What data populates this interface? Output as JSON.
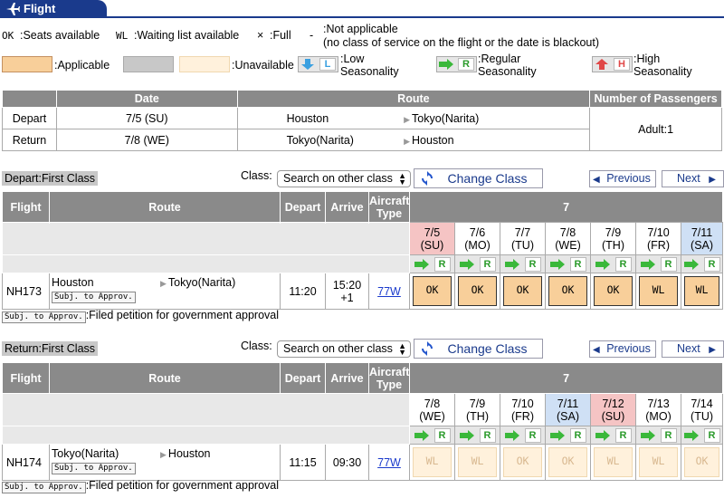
{
  "header": {
    "title": "Flight"
  },
  "legend": {
    "seats_code": "OK",
    "seats_label": ":Seats available",
    "wait_code": "WL",
    "wait_label": ":Waiting list available",
    "full_code": "×",
    "full_label": ":Full",
    "na_code": "-",
    "na_label": ":Not applicable",
    "na_detail": "(no class of service on the flight or the date is blackout)",
    "applicable_label": ":Applicable",
    "unavailable_label": ":Unavailable",
    "low_letter": "L",
    "low_label1": ":Low",
    "low_label2": "Seasonality",
    "regular_letter": "R",
    "regular_label1": ":Regular",
    "regular_label2": "Seasonality",
    "high_letter": "H",
    "high_label1": ":High",
    "high_label2": "Seasonality",
    "colors": {
      "applicable": "#f8cf9a",
      "gray": "#c8c8c8",
      "unavailable": "#fff1dc",
      "low": "#3aa0e0",
      "regular": "#3ab83a",
      "high": "#e04848"
    }
  },
  "summary": {
    "headers": [
      "Date",
      "Route",
      "Number of Passengers"
    ],
    "rows": [
      {
        "label": "Depart",
        "date": "7/5 (SU)",
        "from": "Houston",
        "to": "Tokyo(Narita)"
      },
      {
        "label": "Return",
        "date": "7/8 (WE)",
        "from": "Tokyo(Narita)",
        "to": "Houston"
      }
    ],
    "passengers": "Adult:1"
  },
  "controls": {
    "class_label": "Class:",
    "select_value": "Search on other class",
    "change_class": "Change Class",
    "previous": "Previous",
    "next": "Next"
  },
  "columns": {
    "flight": "Flight",
    "route": "Route",
    "depart": "Depart",
    "arrive": "Arrive",
    "aircraft1": "Aircraft",
    "aircraft2": "Type"
  },
  "depart_section": {
    "title": "Depart:First Class",
    "month": "7",
    "dates": [
      {
        "d": "7/5",
        "w": "(SU)"
      },
      {
        "d": "7/6",
        "w": "(MO)"
      },
      {
        "d": "7/7",
        "w": "(TU)"
      },
      {
        "d": "7/8",
        "w": "(WE)"
      },
      {
        "d": "7/9",
        "w": "(TH)"
      },
      {
        "d": "7/10",
        "w": "(FR)"
      },
      {
        "d": "7/11",
        "w": "(SA)"
      }
    ],
    "flight": {
      "no": "NH173",
      "from": "Houston",
      "to": "Tokyo(Narita)",
      "badge": "Subj. to Approv.",
      "depart": "11:20",
      "arrive1": "15:20",
      "arrive2": "+1",
      "aircraft": "77W",
      "avail": [
        "OK",
        "OK",
        "OK",
        "OK",
        "OK",
        "WL",
        "WL"
      ]
    },
    "note_badge": "Subj. to Approv.",
    "note_text": ":Filed petition for government approval"
  },
  "return_section": {
    "title": "Return:First Class",
    "month": "7",
    "dates": [
      {
        "d": "7/8",
        "w": "(WE)"
      },
      {
        "d": "7/9",
        "w": "(TH)"
      },
      {
        "d": "7/10",
        "w": "(FR)"
      },
      {
        "d": "7/11",
        "w": "(SA)"
      },
      {
        "d": "7/12",
        "w": "(SU)"
      },
      {
        "d": "7/13",
        "w": "(MO)"
      },
      {
        "d": "7/14",
        "w": "(TU)"
      }
    ],
    "flight": {
      "no": "NH174",
      "from": "Tokyo(Narita)",
      "to": "Houston",
      "badge": "Subj. to Approv.",
      "depart": "11:15",
      "arrive1": "09:30",
      "arrive2": "",
      "aircraft": "77W",
      "avail": [
        "WL",
        "WL",
        "OK",
        "OK",
        "WL",
        "WL",
        "OK"
      ]
    },
    "note_badge": "Subj. to Approv.",
    "note_text": ":Filed petition for government approval"
  }
}
